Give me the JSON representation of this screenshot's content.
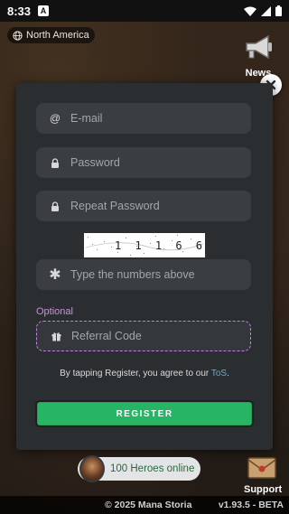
{
  "status_bar": {
    "time": "8:33",
    "notification_icon": "A"
  },
  "region": {
    "label": "North America"
  },
  "news": {
    "label": "News"
  },
  "form": {
    "email_placeholder": "E-mail",
    "password_placeholder": "Password",
    "repeat_password_placeholder": "Repeat Password",
    "captcha_text": "1 1 1 6 6",
    "captcha_placeholder": "Type the numbers above",
    "optional_label": "Optional",
    "referral_placeholder": "Referral Code",
    "tos_prefix": "By tapping Register, you agree to our ",
    "tos_link": "ToS",
    "tos_suffix": ".",
    "register_label": "REGISTER"
  },
  "heroes_online": {
    "label": "100 Heroes online"
  },
  "support": {
    "label": "Support"
  },
  "footer": {
    "copyright": "© 2025 Mana Storia",
    "version": "v1.93.5 - BETA"
  },
  "colors": {
    "accent_green": "#27b465",
    "optional_purple": "#c77ee0",
    "link_blue": "#5ab0e0",
    "modal_bg": "#2b2e31"
  }
}
